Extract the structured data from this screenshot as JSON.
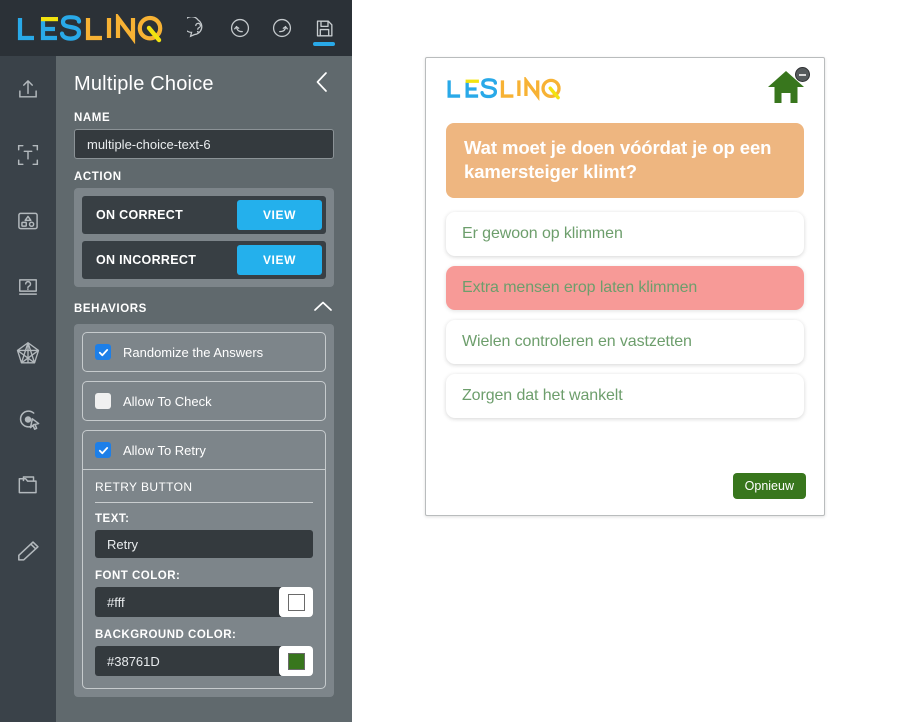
{
  "app": {
    "brand": "LESLINQ",
    "brand_colors": {
      "blue": "#29a9e8",
      "orange": "#f7b234",
      "yellow": "#f2e30f"
    }
  },
  "toolbar": {
    "icons": [
      {
        "name": "help-icon",
        "label": "Help"
      },
      {
        "name": "undo-icon",
        "label": "Undo"
      },
      {
        "name": "redo-icon",
        "label": "Redo"
      },
      {
        "name": "save-icon",
        "label": "Save",
        "active": true
      }
    ],
    "active_accent": "#29a9e8"
  },
  "rail": {
    "items": [
      {
        "name": "upload-icon",
        "label": "Upload"
      },
      {
        "name": "text-icon",
        "label": "Text"
      },
      {
        "name": "layout-icon",
        "label": "Layout"
      },
      {
        "name": "question-icon",
        "label": "Question"
      },
      {
        "name": "network-icon",
        "label": "Network"
      },
      {
        "name": "target-cursor-icon",
        "label": "Interaction"
      },
      {
        "name": "folder-icon",
        "label": "Media"
      },
      {
        "name": "pencil-icon",
        "label": "Draw"
      }
    ]
  },
  "panel": {
    "title": "Multiple Choice",
    "collapse_icon": "chevron-left-icon",
    "name_section": {
      "label": "NAME",
      "value": "multiple-choice-text-6",
      "placeholder": "Name"
    },
    "action_section": {
      "label": "ACTION",
      "rows": [
        {
          "label": "ON CORRECT",
          "button": "VIEW"
        },
        {
          "label": "ON INCORRECT",
          "button": "VIEW"
        }
      ],
      "button_color": "#24b0ec"
    },
    "behaviors_section": {
      "label": "BEHAVIORS",
      "collapse_icon": "chevron-up-icon",
      "items": [
        {
          "label": "Randomize the Answers",
          "checked": true
        },
        {
          "label": "Allow To Check",
          "checked": false
        },
        {
          "label": "Allow To Retry",
          "checked": true
        }
      ],
      "retry_button": {
        "title": "RETRY BUTTON",
        "text_label": "TEXT:",
        "text_value": "Retry",
        "font_color_label": "FONT COLOR:",
        "font_color_value": "#fff",
        "font_color_swatch": "#ffffff",
        "bg_color_label": "BACKGROUND COLOR:",
        "bg_color_value": "#38761D",
        "bg_color_swatch": "#38761D"
      }
    },
    "checkbox_on_color": "#1d7fe8"
  },
  "preview": {
    "brand": "LESLINQ",
    "home_icon": "home-icon",
    "home_color": "#38761d",
    "badge_icon": "minus-badge-icon",
    "question": {
      "text": "Wat moet je doen vóórdat je op een kamersteiger klimt?",
      "background": "#eeb680",
      "color": "#ffffff"
    },
    "answers": [
      {
        "text": "Er gewoon op klimmen",
        "state": "default"
      },
      {
        "text": "Extra mensen erop laten klimmen",
        "state": "wrong"
      },
      {
        "text": "Wielen controleren en vastzetten",
        "state": "default"
      },
      {
        "text": "Zorgen dat het wankelt",
        "state": "default"
      }
    ],
    "answer_text_color": "#6d9e6c",
    "wrong_background": "#f79a97",
    "retry_button": {
      "label": "Opnieuw",
      "background": "#38761d",
      "color": "#ffffff"
    }
  }
}
